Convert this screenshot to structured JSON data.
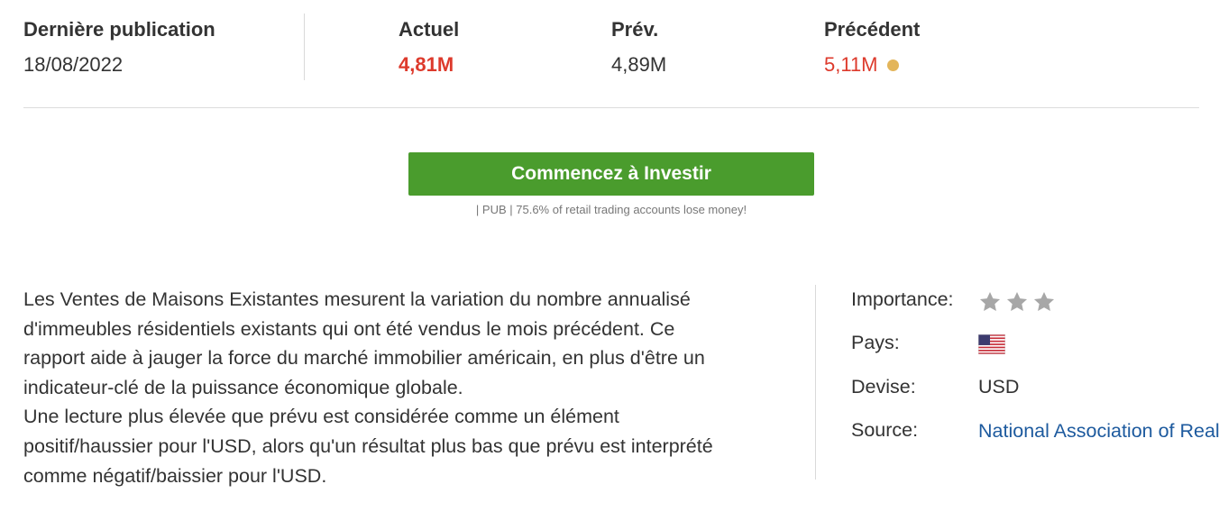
{
  "summary": {
    "last_release_label": "Dernière publication",
    "last_release_date": "18/08/2022",
    "actual_label": "Actuel",
    "actual_value": "4,81M",
    "forecast_label": "Prév.",
    "forecast_value": "4,89M",
    "previous_label": "Précédent",
    "previous_value": "5,11M",
    "colors": {
      "negative": "#dd3a2c",
      "revised_dot": "#e3b55a"
    }
  },
  "cta": {
    "button_label": "Commencez à Investir",
    "button_color": "#4a9c2d",
    "disclaimer": "| PUB | 75.6% of retail trading accounts lose money!"
  },
  "description": {
    "paragraph_1": "Les Ventes de Maisons Existantes mesurent la variation du nombre annualisé d'immeubles résidentiels existants qui ont été vendus le mois précédent. Ce rapport aide à jauger la force du marché immobilier américain, en plus d'être un indicateur-clé de la puissance économique globale.",
    "paragraph_2": "Une lecture plus élevée que prévu est considérée comme un élément positif/haussier pour l'USD, alors qu'un résultat plus bas que prévu est interprété comme négatif/baissier pour l'USD."
  },
  "info": {
    "importance_label": "Importance:",
    "importance_stars": 3,
    "importance_icon": "star-icon",
    "country_label": "Pays:",
    "country_icon": "us-flag-icon",
    "currency_label": "Devise:",
    "currency_value": "USD",
    "source_label": "Source:",
    "source_value": "National Association of Realto..."
  }
}
